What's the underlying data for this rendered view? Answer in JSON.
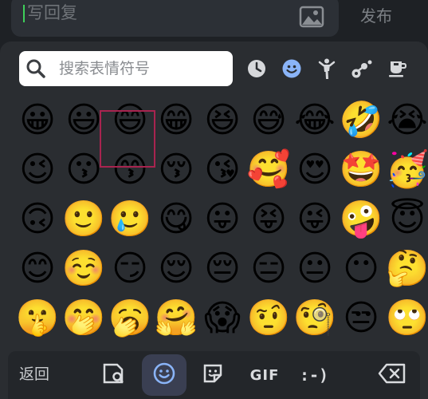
{
  "reply_bar": {
    "placeholder": "写回复",
    "publish_label": "发布"
  },
  "search": {
    "placeholder": "搜索表情符号"
  },
  "category_tabs": [
    {
      "name": "recent-icon"
    },
    {
      "name": "smileys-icon",
      "active": true
    },
    {
      "name": "people-activity-icon"
    },
    {
      "name": "animals-nature-icon"
    },
    {
      "name": "food-drink-icon"
    }
  ],
  "emoji_rows": [
    [
      "😀",
      "😃",
      "😄",
      "😁",
      "😆",
      "😅",
      "😂",
      "🤣",
      "😭"
    ],
    [
      "😉",
      "😗",
      "😙",
      "😚",
      "😘",
      "🥰",
      "😍",
      "🤩",
      "🥳"
    ],
    [
      "🙃",
      "🙂",
      "🥲",
      "😋",
      "😛",
      "😝",
      "😜",
      "🤪",
      "😇"
    ],
    [
      "😊",
      "☺️",
      "😏",
      "😌",
      "😔",
      "😑",
      "😐",
      "😶",
      "🤔"
    ],
    [
      "🤫",
      "🤭",
      "🥱",
      "🤗",
      "😱",
      "🤨",
      "🧐",
      "😒",
      "🙄"
    ]
  ],
  "selected_emoji": "🥲",
  "bottom_bar": {
    "back_label": "返回",
    "gif_label": "GIF",
    "emoticon_label": ":-)"
  },
  "colors": {
    "background": "#1e2125",
    "panel": "#2a2d31",
    "active_tab": "#8ab4f8",
    "selection_border": "#a8244f",
    "caret": "#3ecf5a"
  }
}
